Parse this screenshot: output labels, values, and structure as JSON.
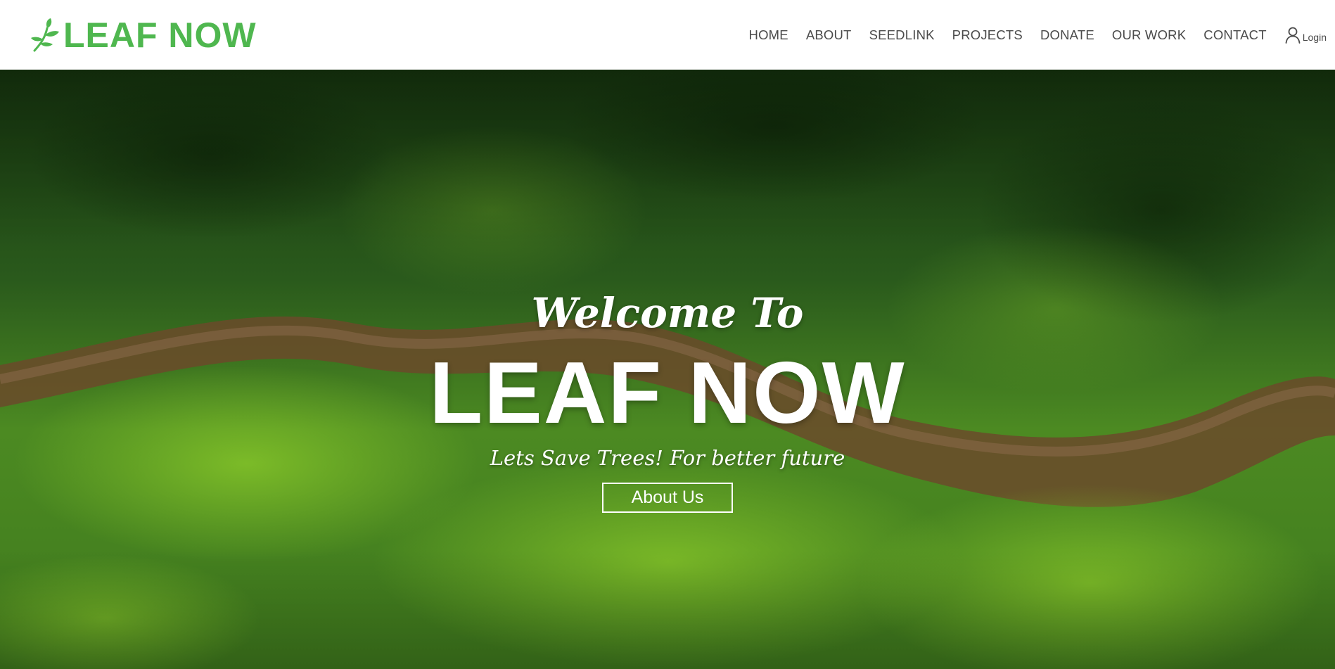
{
  "brand": {
    "name": "LEAF NOW",
    "icon": "leaf-sprig-icon",
    "color": "#4fb74f"
  },
  "nav": {
    "items": [
      {
        "label": "HOME"
      },
      {
        "label": "ABOUT"
      },
      {
        "label": "SEEDLINK"
      },
      {
        "label": "PROJECTS"
      },
      {
        "label": "DONATE"
      },
      {
        "label": "OUR WORK"
      },
      {
        "label": "CONTACT"
      }
    ],
    "login": {
      "icon": "user-icon",
      "label": "Login"
    }
  },
  "hero": {
    "background": "aerial-forest-river-photo",
    "welcome": "Welcome To",
    "title": "LEAF NOW",
    "tagline": "Lets Save Trees! For better future",
    "button_label": "About Us"
  }
}
